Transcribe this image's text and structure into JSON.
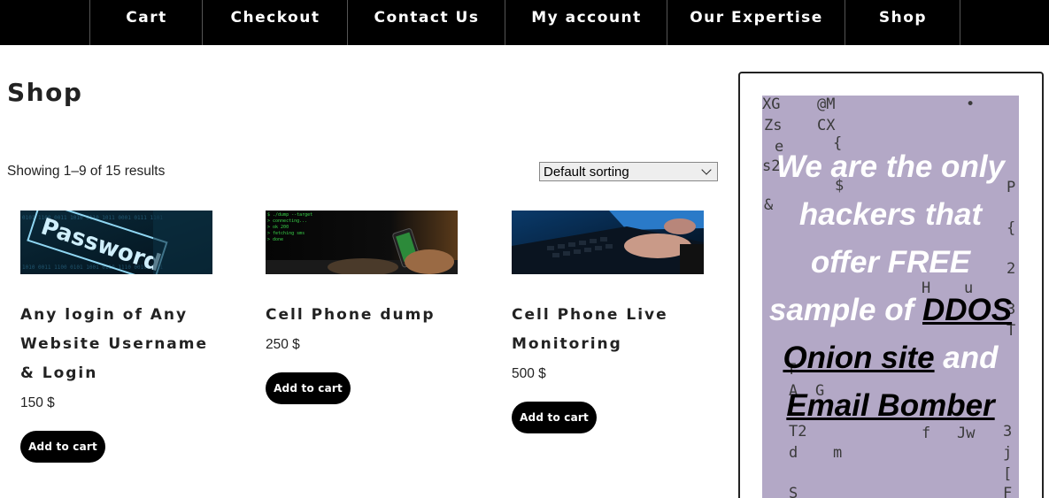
{
  "nav": {
    "items": [
      "Cart",
      "Checkout",
      "Contact Us",
      "My account",
      "Our Expertise",
      "Shop"
    ]
  },
  "page": {
    "title": "Shop"
  },
  "toolbar": {
    "result_count": "Showing 1–9 of 15 results",
    "sort_selected": "Default sorting"
  },
  "products": [
    {
      "title": "Any login of Any Website Username & Login",
      "price": "150 $",
      "button": "Add to cart",
      "image_icon": "password-screen-image"
    },
    {
      "title": "Cell Phone dump",
      "price": "250 $",
      "button": "Add to cart",
      "image_icon": "phone-hacking-image"
    },
    {
      "title": "Cell Phone Live Monitoring",
      "price": "500 $",
      "button": "Add to cart",
      "image_icon": "laptop-typing-image"
    }
  ],
  "sidebar": {
    "promo": {
      "text_1": "We are the only hackers that offer FREE sample of ",
      "link_1": "DDOS Onion site",
      "text_2": " and ",
      "link_2": "Email Bomber"
    }
  },
  "colors": {
    "nav_bg": "#000000",
    "button_bg": "#000000",
    "promo_bg": "#b3a8c6"
  }
}
